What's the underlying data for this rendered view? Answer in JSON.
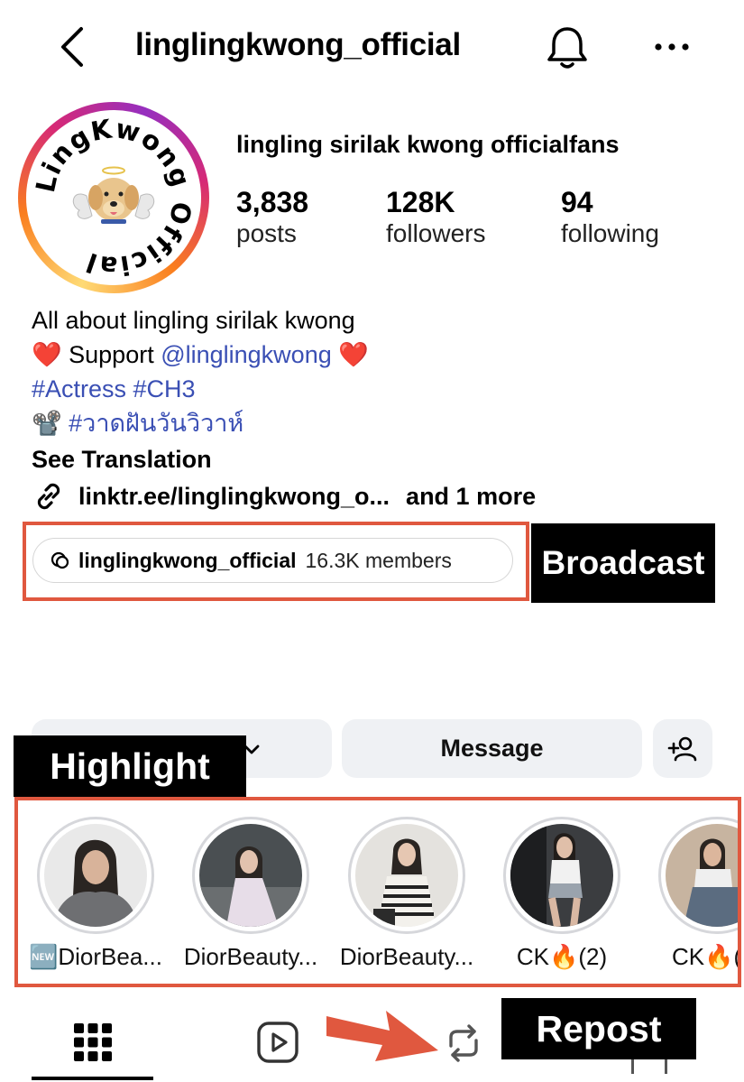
{
  "header": {
    "title": "linglingkwong_official"
  },
  "profile": {
    "display_name": "lingling sirilak kwong officialfans",
    "avatar_text": "LingKwong Official",
    "stats": {
      "posts": {
        "value": "3,838",
        "label": "posts"
      },
      "followers": {
        "value": "128K",
        "label": "followers"
      },
      "following": {
        "value": "94",
        "label": "following"
      }
    }
  },
  "bio": {
    "line1": "All about lingling sirilak kwong",
    "line2_prefix": "Support ",
    "line2_mention": "@linglingkwong",
    "heart_emoji": "❤️",
    "hashtags": "#Actress #CH3",
    "film_emoji": "📽️",
    "thai_hashtag": "#วาดฝันวันวิวาห์",
    "see_translation": "See Translation",
    "link": "linktr.ee/linglingkwong_o...",
    "link_more": "and 1 more"
  },
  "broadcast": {
    "channel_name": "linglingkwong_official",
    "members": "16.3K members",
    "annotation": "Broadcast"
  },
  "actions": {
    "message_label": "Message"
  },
  "highlights": {
    "annotation": "Highlight",
    "items": [
      {
        "label": "🆕DiorBea..."
      },
      {
        "label": "DiorBeauty..."
      },
      {
        "label": "DiorBeauty..."
      },
      {
        "label": "CK🔥(2)"
      },
      {
        "label": "CK🔥("
      }
    ]
  },
  "annotations": {
    "repost": "Repost"
  },
  "colors": {
    "annotation_border": "#e0583f",
    "link_blue": "#3a4fb4",
    "button_bg": "#eff1f4"
  }
}
